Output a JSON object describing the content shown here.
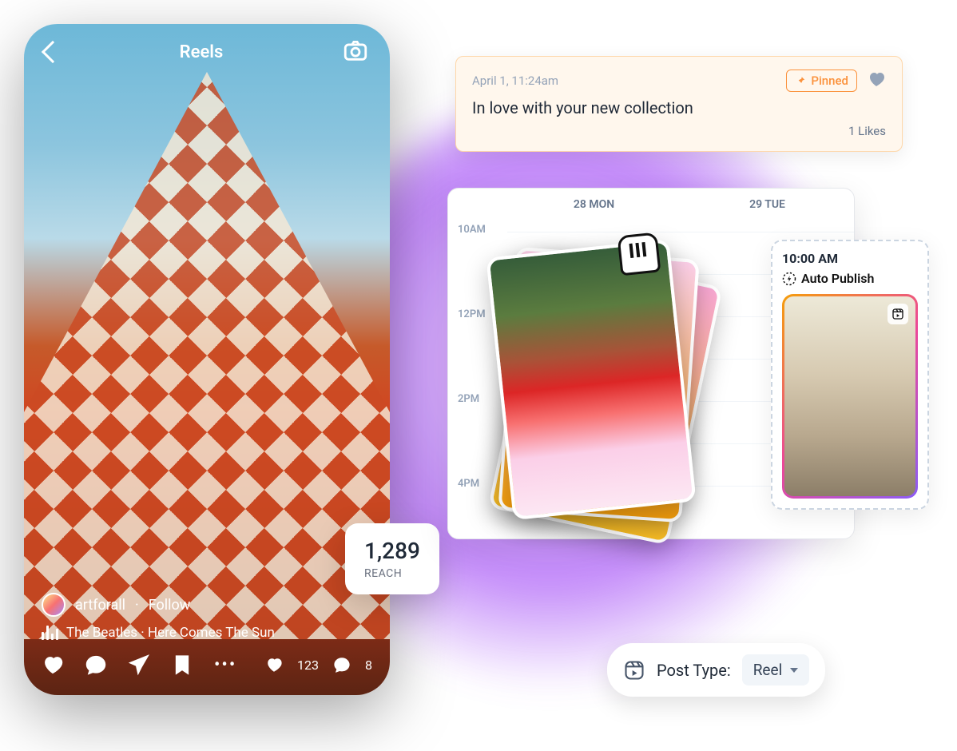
{
  "phone": {
    "title": "Reels",
    "user": "artforall",
    "follow": "Follow",
    "music": "The Beatles · Here Comes The Sun",
    "likes": "123",
    "comments": "8"
  },
  "reach": {
    "value": "1,289",
    "label": "REACH"
  },
  "comment": {
    "time": "April 1, 11:24am",
    "pinned": "Pinned",
    "text": "In love with your new collection",
    "likes": "1 Likes"
  },
  "calendar": {
    "days": [
      "28 MON",
      "29 TUE"
    ],
    "times": [
      "10AM",
      "12PM",
      "2PM",
      "4PM"
    ]
  },
  "schedule": {
    "time": "10:00 AM",
    "auto_publish": "Auto Publish"
  },
  "post_type": {
    "label": "Post Type:",
    "value": "Reel"
  }
}
